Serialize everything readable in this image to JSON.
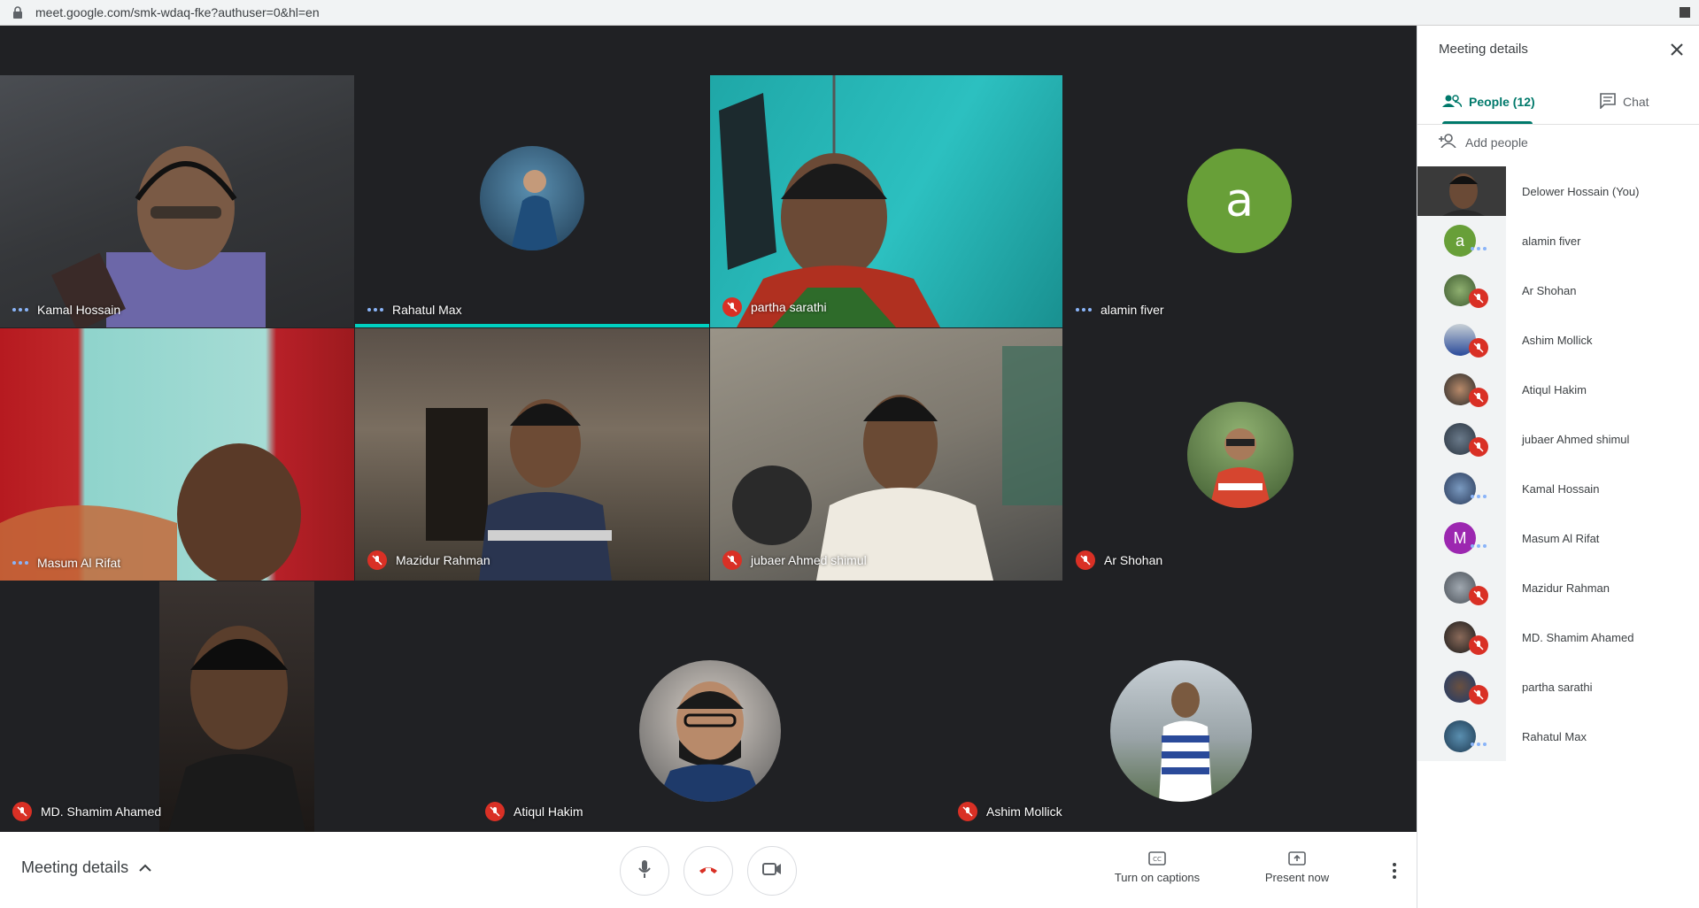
{
  "browser": {
    "url": "meet.google.com/smk-wdaq-fke?authuser=0&hl=en"
  },
  "tiles": [
    {
      "name": "Kamal Hossain",
      "status": "speaking-dots"
    },
    {
      "name": "Rahatul Max",
      "status": "speaking-dots"
    },
    {
      "name": "partha sarathi",
      "status": "muted"
    },
    {
      "name": "alamin fiver",
      "status": "speaking-dots",
      "avatar_letter": "a",
      "avatar_color": "#689f38"
    },
    {
      "name": "Masum Al Rifat",
      "status": "speaking-dots"
    },
    {
      "name": "Mazidur Rahman",
      "status": "muted"
    },
    {
      "name": "jubaer Ahmed shimul",
      "status": "muted"
    },
    {
      "name": "Ar Shohan",
      "status": "muted"
    },
    {
      "name": "MD. Shamim Ahamed",
      "status": "muted"
    },
    {
      "name": "Atiqul Hakim",
      "status": "muted"
    },
    {
      "name": "Ashim Mollick",
      "status": "muted"
    }
  ],
  "bottombar": {
    "meeting_details": "Meeting details",
    "captions_label": "Turn on captions",
    "present_label": "Present now"
  },
  "panel": {
    "title": "Meeting details",
    "tab_people": "People (12)",
    "tab_chat": "Chat",
    "add_people": "Add people",
    "people": [
      {
        "name": "Delower Hossain (You)",
        "status": "none"
      },
      {
        "name": "alamin fiver",
        "status": "dots",
        "avatar_letter": "a",
        "avatar_color": "#689f38"
      },
      {
        "name": "Ar Shohan",
        "status": "muted"
      },
      {
        "name": "Ashim Mollick",
        "status": "muted"
      },
      {
        "name": "Atiqul Hakim",
        "status": "muted"
      },
      {
        "name": "jubaer Ahmed shimul",
        "status": "muted"
      },
      {
        "name": "Kamal Hossain",
        "status": "dots"
      },
      {
        "name": "Masum Al Rifat",
        "status": "dots",
        "avatar_letter": "M",
        "avatar_color": "#9c27b0"
      },
      {
        "name": "Mazidur Rahman",
        "status": "muted"
      },
      {
        "name": "MD. Shamim Ahamed",
        "status": "muted"
      },
      {
        "name": "partha sarathi",
        "status": "muted"
      },
      {
        "name": "Rahatul Max",
        "status": "dots"
      }
    ]
  },
  "colors": {
    "accent": "#00796b",
    "mute": "#d93025",
    "hangup": "#d93025",
    "stage": "#202124"
  }
}
